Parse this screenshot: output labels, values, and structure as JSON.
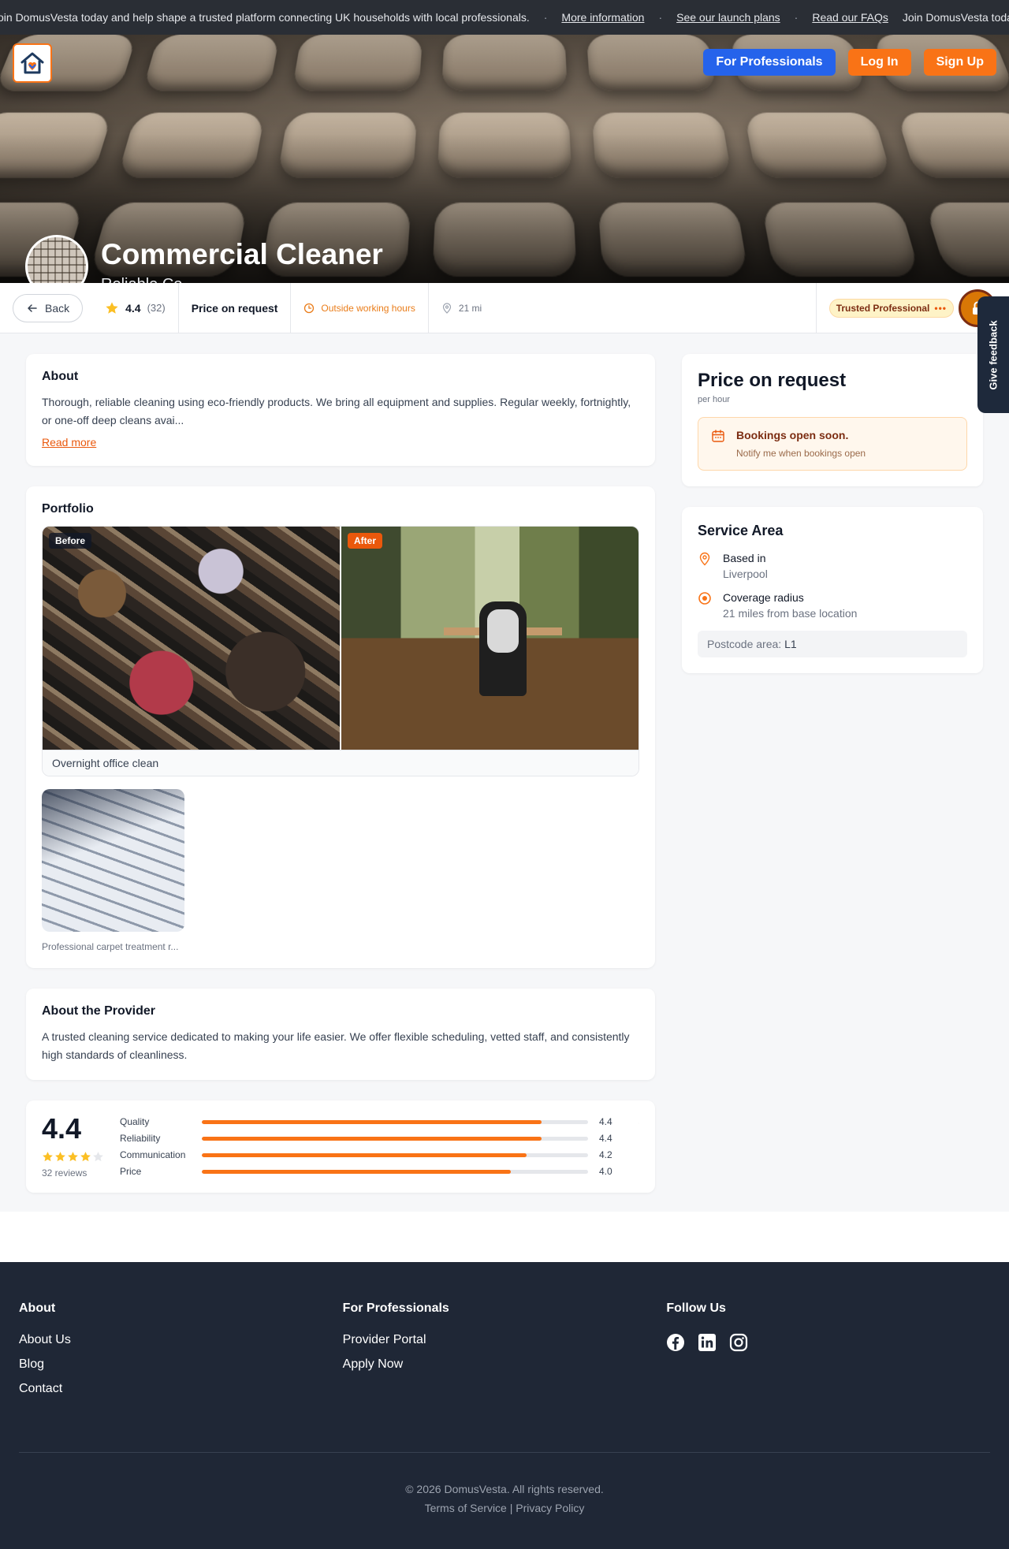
{
  "announcement": {
    "lead_text": "Join DomusVesta today and help shape a trusted platform connecting UK households with local professionals.",
    "links": [
      "More information",
      "See our launch plans",
      "Read our FAQs"
    ],
    "tail_text": "Join DomusVesta today and help sh"
  },
  "nav": {
    "for_professionals": "For Professionals",
    "log_in": "Log In",
    "sign_up": "Sign Up"
  },
  "hero": {
    "title": "Commercial Cleaner",
    "company": "Reliable Co"
  },
  "infobar": {
    "back": "Back",
    "rating": "4.4",
    "rating_count": "(32)",
    "price": "Price on request",
    "hours": "Outside working hours",
    "distance": "21 mi",
    "badge": "Trusted Professional"
  },
  "feedback": "Give feedback",
  "about": {
    "heading": "About",
    "text": "Thorough, reliable cleaning using eco-friendly products. We bring all equipment and supplies. Regular weekly, fortnightly, or one-off deep cleans avai...",
    "read_more": "Read more"
  },
  "portfolio": {
    "heading": "Portfolio",
    "before_tag": "Before",
    "after_tag": "After",
    "main_caption": "Overnight office clean",
    "thumb_caption": "Professional carpet treatment r..."
  },
  "provider": {
    "heading": "About the Provider",
    "text": "A trusted cleaning service dedicated to making your life easier. We offer flexible scheduling, vetted staff, and consistently high standards of cleanliness."
  },
  "reviews": {
    "score": "4.4",
    "stars": 4.4,
    "count": "32 reviews",
    "bars": [
      {
        "label": "Quality",
        "value": "4.4",
        "fraction": 0.88
      },
      {
        "label": "Reliability",
        "value": "4.4",
        "fraction": 0.88
      },
      {
        "label": "Communication",
        "value": "4.2",
        "fraction": 0.84
      },
      {
        "label": "Price",
        "value": "4.0",
        "fraction": 0.8
      }
    ]
  },
  "price_card": {
    "heading": "Price on request",
    "per": "per hour",
    "notice_title": "Bookings open soon.",
    "notice_sub": "Notify me when bookings open"
  },
  "service_area": {
    "heading": "Service Area",
    "based_label": "Based in",
    "based_value": "Liverpool",
    "radius_label": "Coverage radius",
    "radius_value": "21 miles from base location",
    "postcode_label": "Postcode area:",
    "postcode_value": "L1"
  },
  "footer": {
    "about_heading": "About",
    "about_links": [
      "About Us",
      "Blog",
      "Contact"
    ],
    "pro_heading": "For Professionals",
    "pro_links": [
      "Provider Portal",
      "Apply Now"
    ],
    "follow_heading": "Follow Us",
    "copyright": "© 2026 DomusVesta. All rights reserved.",
    "terms": "Terms of Service",
    "separator": "|",
    "privacy": "Privacy Policy"
  },
  "colors": {
    "accent_orange": "#f97316",
    "brand_blue": "#2563eb",
    "footer_bg": "#1f2736",
    "star": "#fbbf24"
  }
}
